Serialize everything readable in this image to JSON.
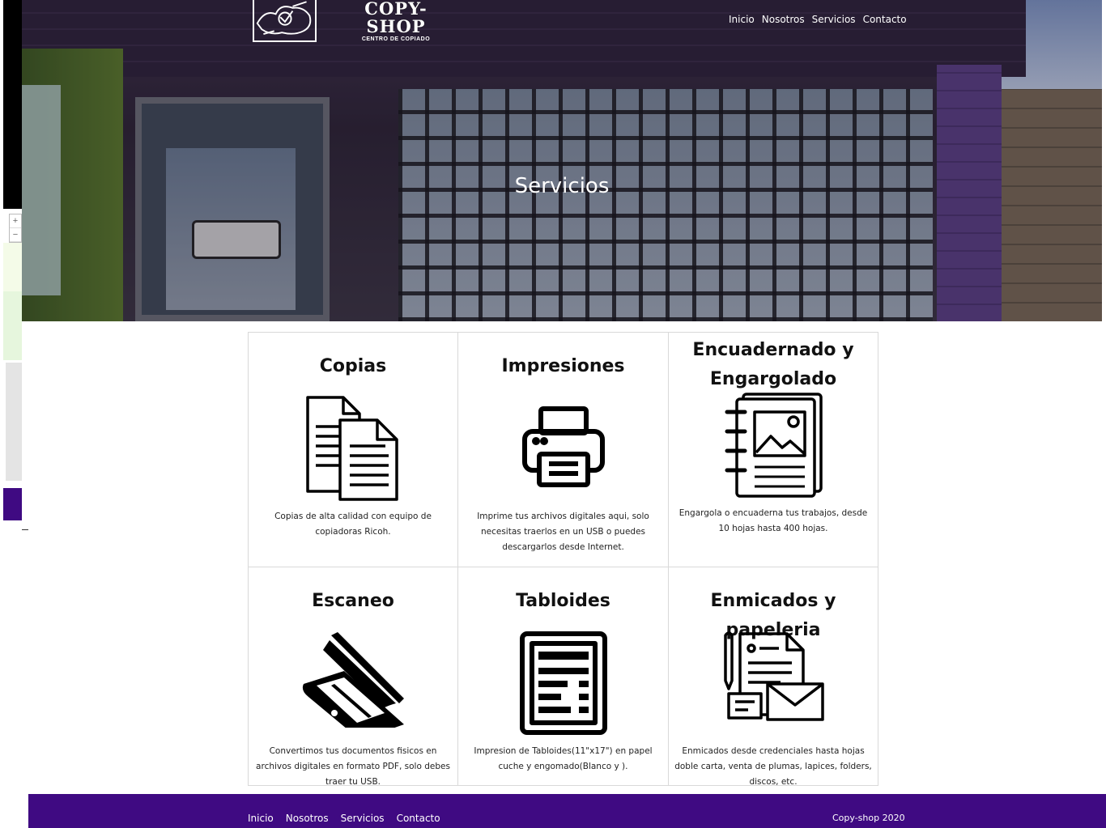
{
  "brand": {
    "name": "COPY-SHOP",
    "subtitle": "CENTRO DE COPIADO"
  },
  "nav": [
    "Inicio",
    "Nosotros",
    "Servicios",
    "Contacto"
  ],
  "hero": {
    "title": "Servicios"
  },
  "zoom": {
    "in": "+",
    "out": "−"
  },
  "services": [
    {
      "title": "Copias",
      "icon": "documents-icon",
      "text": "Copias de alta calidad con equipo de copiadoras Ricoh."
    },
    {
      "title": "Impresiones",
      "icon": "printer-icon",
      "text": "Imprime tus archivos digitales aqui, solo necesitas traerlos en un USB o puedes descargarlos desde Internet."
    },
    {
      "title": "Encuadernado y Engargolado",
      "icon": "notebook-icon",
      "text": "Engargola o encuaderna tus trabajos, desde 10 hojas hasta 400 hojas."
    },
    {
      "title": "Escaneo",
      "icon": "scanner-icon",
      "text": "Convertimos tus documentos fisicos en archivos digitales en formato PDF, solo debes traer tu USB."
    },
    {
      "title": "Tabloides",
      "icon": "tabloid-icon",
      "text": "Impresion de Tabloides(11\"x17\") en papel cuche y engomado(Blanco y )."
    },
    {
      "title": "Enmicados y papeleria",
      "icon": "stationery-icon",
      "text": "Enmicados desde credenciales hasta hojas doble carta, venta de plumas, lapices, folders, discos, etc."
    }
  ],
  "footer": {
    "nav": [
      "Inicio",
      "Nosotros",
      "Servicios",
      "Contacto"
    ],
    "copyright": "Copy-shop 2020"
  },
  "colors": {
    "primary": "#3f0a82",
    "text": "#111111",
    "border": "#d9d9d9"
  }
}
